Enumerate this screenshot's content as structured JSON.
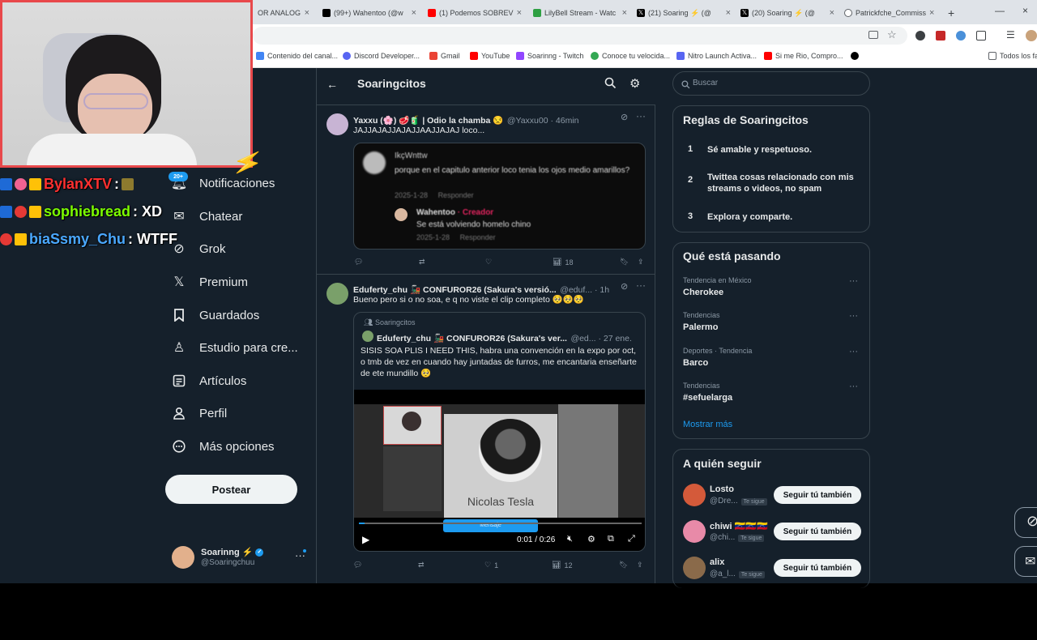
{
  "browser": {
    "tabs": [
      {
        "label": "OR ANALOG",
        "color": "#888"
      },
      {
        "label": "(99+) Wahentoo (@w",
        "color": "#000"
      },
      {
        "label": "(1) Podemos SOBREV",
        "color": "#ff0000"
      },
      {
        "label": "LilyBell Stream - Watc",
        "color": "#2ea043"
      },
      {
        "label": "(21) Soaring ⚡ (@",
        "color": "#000"
      },
      {
        "label": "(20) Soaring ⚡ (@",
        "color": "#000"
      },
      {
        "label": "Patrickfche_Commiss",
        "color": "#5f6368"
      }
    ],
    "new_tab": "+",
    "bookmarks": [
      {
        "label": "Contenido del canal...",
        "color": "#4285f4"
      },
      {
        "label": "Discord Developer...",
        "color": "#5865f2"
      },
      {
        "label": "Gmail",
        "color": "#ea4335"
      },
      {
        "label": "YouTube",
        "color": "#ff0000"
      },
      {
        "label": "Soarinng - Twitch",
        "color": "#9146ff"
      },
      {
        "label": "Conoce tu velocida...",
        "color": "#34a853"
      },
      {
        "label": "Nitro Launch Activa...",
        "color": "#5865f2"
      },
      {
        "label": "Si me Rio, Compro...",
        "color": "#ff0000"
      }
    ],
    "bookmarks_folder": "Todos los fa"
  },
  "stream": {
    "chat": [
      {
        "user": "BylanXTV",
        "message": ":",
        "color": "#ff3030"
      },
      {
        "user": "sophiebread",
        "message": ": XD",
        "color": "#7cfc00"
      },
      {
        "user": "biaSsmy_Chu",
        "message": ": WTFF",
        "color": "#4aa8ff"
      }
    ]
  },
  "sidebar": {
    "notif_badge": "20+",
    "items": [
      {
        "label": "Notificaciones",
        "icon": "bell-icon"
      },
      {
        "label": "Chatear",
        "icon": "mail-icon"
      },
      {
        "label": "Grok",
        "icon": "grok-icon"
      },
      {
        "label": "Premium",
        "icon": "x-logo-icon"
      },
      {
        "label": "Guardados",
        "icon": "bookmark-icon"
      },
      {
        "label": "Estudio para cre...",
        "icon": "studio-icon"
      },
      {
        "label": "Artículos",
        "icon": "article-icon"
      },
      {
        "label": "Perfil",
        "icon": "person-icon"
      },
      {
        "label": "Más opciones",
        "icon": "more-circle-icon"
      }
    ],
    "post_button": "Postear",
    "account": {
      "name": "Soarinng ⚡",
      "handle": "@Soaringchuu"
    }
  },
  "feed": {
    "title": "Soaringcitos",
    "tweets": [
      {
        "name": "Yaxxu (🌸) 🥩🧃 | Odio la chamba 😒",
        "handle": "@Yaxxu00 · 46min",
        "text": "JAJJAJAJJAJAJJAAJJAJAJ loco...",
        "embed": {
          "user": "IkçWnttw",
          "comment": "porque en el capitulo anterior loco tenia los ojos medio amarillos?",
          "date1": "2025-1-28",
          "reply1": "Responder",
          "reply_user": "Wahentoo",
          "creator": "· Creador",
          "reply_text": "Se está volviendo homelo chino",
          "date2": "2025-1-28",
          "reply2": "Responder"
        },
        "views": "18",
        "likes": "",
        "replies": "",
        "retweets": ""
      },
      {
        "name": "Eduferty_chu 🚂 CONFUROR26 (Sakura's versió...",
        "handle": "@eduf... · 1h",
        "text": "Bueno pero si o no soa, e q no viste el clip completo 🥺🥺🥺",
        "quote": {
          "community": "Soaringcitos",
          "name": "Eduferty_chu 🚂 CONFUROR26 (Sakura's ver...",
          "handle": "@ed... · 27 ene.",
          "text": "SISIS SOA PLIS I NEED THIS, habra una convención en la expo por oct, o tmb de vez en cuando hay juntadas de furros, me encantaria enseñarte de ete mundillo 🥺"
        },
        "video": {
          "caption": "Nicolas Tesla",
          "time": "0:01 / 0:26",
          "message_label": "Mensaje"
        },
        "likes": "1",
        "views": "12"
      }
    ]
  },
  "right": {
    "search_placeholder": "Buscar",
    "rules_title": "Reglas de Soaringcitos",
    "rules": [
      {
        "num": "1",
        "text": "Sé amable y respetuoso."
      },
      {
        "num": "2",
        "text": "Twittea cosas relacionado con mis streams o videos, no spam"
      },
      {
        "num": "3",
        "text": "Explora y comparte."
      }
    ],
    "trends_title": "Qué está pasando",
    "trends": [
      {
        "category": "Tendencia en México",
        "name": "Cherokee"
      },
      {
        "category": "Tendencias",
        "name": "Palermo"
      },
      {
        "category": "Deportes · Tendencia",
        "name": "Barco"
      },
      {
        "category": "Tendencias",
        "name": "#sefuelarga"
      }
    ],
    "show_more": "Mostrar más",
    "follow_title": "A quién seguir",
    "follow": [
      {
        "name": "Losto",
        "handle": "@Dre...",
        "badge": "Te sigue",
        "button": "Seguir tú también",
        "color": "#d45a3a"
      },
      {
        "name": "chiwi 🇻🇪🇻🇪🇻🇪",
        "handle": "@chi...",
        "badge": "Te sigue",
        "button": "Seguir tú también",
        "color": "#e88aa8"
      },
      {
        "name": "alix",
        "handle": "@a_l...",
        "badge": "Te sigue",
        "button": "Seguir tú también",
        "color": "#8a6a4a"
      }
    ]
  },
  "colors": {
    "bg": "#15202b",
    "accent": "#1d9bf0",
    "border": "#38444d",
    "cam_border": "#e8484b"
  }
}
